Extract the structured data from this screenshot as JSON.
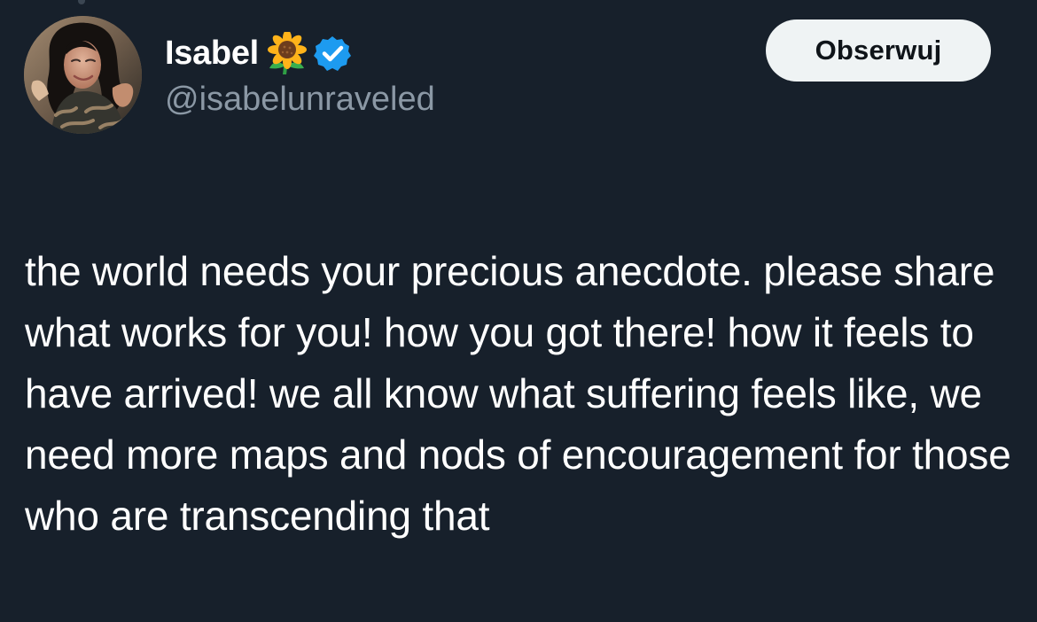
{
  "tweet": {
    "author": {
      "display_name": "Isabel",
      "name_emoji": "🌻",
      "handle": "@isabelunraveled",
      "avatar_icon": "profile-photo",
      "verified_icon": "verified-check-icon",
      "verified_color": "#1d9bf0"
    },
    "follow_button": {
      "label": "Obserwuj"
    },
    "body": {
      "text": "the world needs your precious anecdote. please share what works for you! how you got there! how it feels to have arrived! we all know what suffering feels like, we need more maps and nods of encouragement for those who are transcending that"
    }
  },
  "theme": {
    "background": "#17202b",
    "text": "#ffffff",
    "secondary_text": "#8b98a5",
    "button_background": "#eff3f4",
    "button_text": "#0f1419"
  }
}
